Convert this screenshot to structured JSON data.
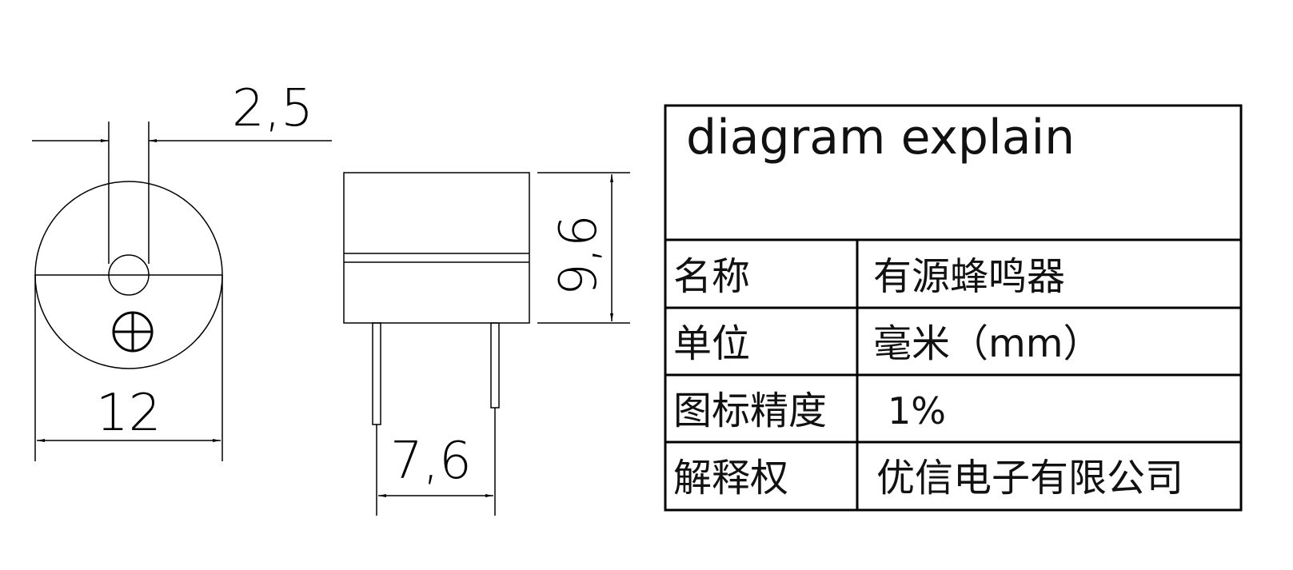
{
  "front_view": {
    "dim_top": "2,5",
    "dim_bottom": "12"
  },
  "side_view": {
    "dim_height": "9,6",
    "dim_pin_spacing": "7,6"
  },
  "table": {
    "title": "diagram explain",
    "rows": [
      {
        "label": "名称",
        "value": "有源蜂鸣器"
      },
      {
        "label": "单位",
        "value": "毫米（mm）"
      },
      {
        "label": "图标精度",
        "value": "1%"
      },
      {
        "label": "解释权",
        "value": "优信电子有限公司"
      }
    ]
  }
}
